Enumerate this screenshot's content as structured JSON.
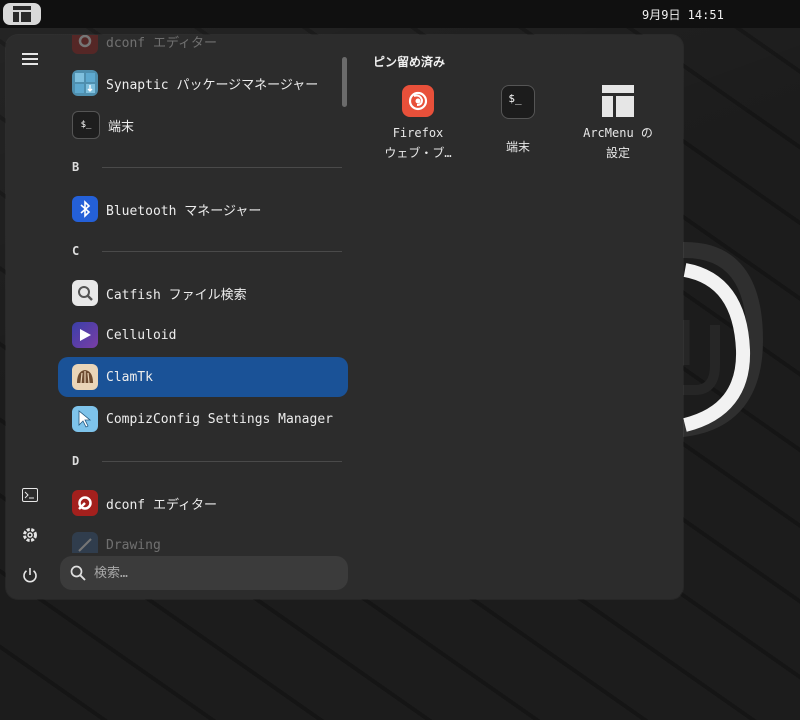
{
  "panel": {
    "clock": "9月9日  14:51"
  },
  "menu": {
    "pinned_title": "ピン留め済み",
    "search_placeholder": "検索…",
    "list": [
      {
        "type": "app",
        "label": "dconf エディター",
        "icon": "dconf-editor-icon",
        "partial": true
      },
      {
        "type": "app",
        "label": "Synaptic パッケージマネージャー",
        "icon": "synaptic-icon"
      },
      {
        "type": "app",
        "label": "端末",
        "icon": "terminal-icon"
      },
      {
        "type": "section",
        "label": "B"
      },
      {
        "type": "app",
        "label": "Bluetooth マネージャー",
        "icon": "bluetooth-icon"
      },
      {
        "type": "section",
        "label": "C"
      },
      {
        "type": "app",
        "label": "Catfish ファイル検索",
        "icon": "catfish-search-icon"
      },
      {
        "type": "app",
        "label": "Celluloid",
        "icon": "celluloid-icon"
      },
      {
        "type": "app",
        "label": "ClamTk",
        "icon": "clamtk-icon",
        "selected": true
      },
      {
        "type": "app",
        "label": "CompizConfig Settings Manager",
        "icon": "compizconfig-icon"
      },
      {
        "type": "section",
        "label": "D"
      },
      {
        "type": "app",
        "label": "dconf エディター",
        "icon": "dconf-editor-icon"
      },
      {
        "type": "app",
        "label": "Drawing",
        "icon": "drawing-icon",
        "partial": true
      }
    ],
    "pinned": [
      {
        "label": "Firefox ウェブ・ブ…",
        "line1": "Firefox",
        "line2": "ウェブ・ブ…",
        "icon": "firefox-icon"
      },
      {
        "label": "端末",
        "line1": "端末",
        "line2": "",
        "icon": "terminal-icon"
      },
      {
        "label": "ArcMenu の設定",
        "line1": "ArcMenu の",
        "line2": "設定",
        "icon": "arcmenu-settings-icon"
      }
    ]
  },
  "colors": {
    "selection": "#1a5297",
    "menu_bg": "#2c2c2c",
    "firefox": "#e8503a"
  }
}
